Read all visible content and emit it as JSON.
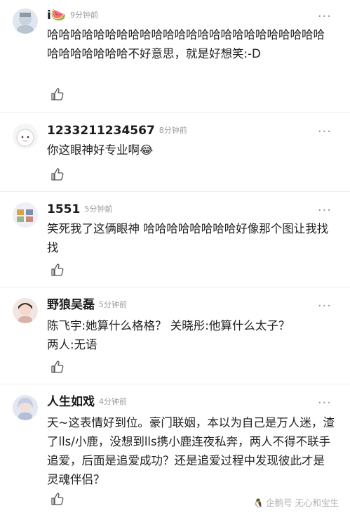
{
  "comments": [
    {
      "user": "i🍉",
      "time": "9分钟前",
      "text": "哈哈哈哈哈哈哈哈哈哈哈哈哈哈哈哈哈哈哈哈哈哈哈哈哈哈哈哈哈哈哈不好意思，就是好想笑:-D"
    },
    {
      "user": "1233211234567",
      "time": "8分钟前",
      "text": "你这眼神好专业啊😂"
    },
    {
      "user": "1551",
      "time": "5分钟前",
      "text": "笑死我了这俩眼神 哈哈哈哈哈哈哈哈好像那个图让我找找"
    },
    {
      "user": "野狼吴磊",
      "time": "5分钟前",
      "text_lines": [
        "陈飞宇:她算什么格格？ 关晓彤:他算什么太子？",
        "两人:无语"
      ]
    },
    {
      "user": "人生如戏",
      "time": "4分钟前",
      "text": "天~这表情好到位。豪门联姻，本以为自己是万人迷，渣了lls/小鹿，没想到lls携小鹿连夜私奔，两人不得不联手追爱，后面是追爱成功？还是追爱过程中发现彼此才是灵魂伴侣？"
    }
  ],
  "more_icon": "···",
  "footer": {
    "logo": "企鹅号",
    "account": "无心和宝生"
  },
  "icons": {
    "like": "thumbs-up-icon",
    "more": "more-dots-icon"
  }
}
